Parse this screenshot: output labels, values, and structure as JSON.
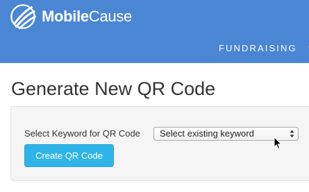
{
  "header": {
    "logo": {
      "icon": "mobilecause-globe-icon",
      "brand_bold": "Mobile",
      "brand_regular": "Cause"
    },
    "nav": {
      "label": "FUNDRAISING",
      "icon": "chevron-down-icon"
    },
    "background_color": "#4a86d4"
  },
  "main": {
    "title": "Generate New QR Code",
    "form": {
      "keyword_label": "Select Keyword for QR Code",
      "keyword_select": {
        "selected": "Select existing keyword",
        "icon": "select-arrows-icon"
      },
      "submit_label": "Create QR Code",
      "submit_color": "#2fb4ea"
    }
  },
  "cursor": {
    "icon": "mouse-pointer-icon"
  }
}
